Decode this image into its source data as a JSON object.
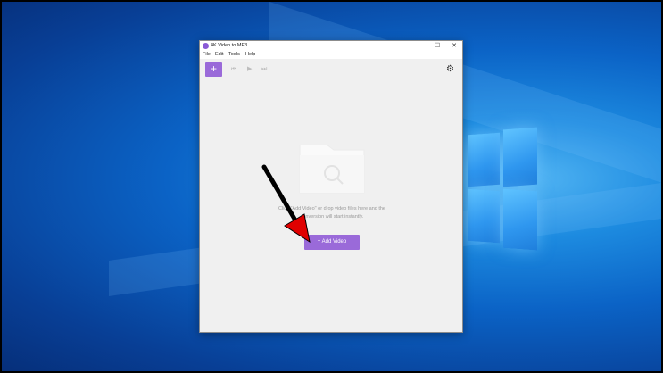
{
  "window": {
    "title": "4K Video to MP3",
    "controls": {
      "minimize": "—",
      "maximize": "☐",
      "close": "✕"
    }
  },
  "menu": {
    "items": [
      "File",
      "Edit",
      "Tools",
      "Help"
    ]
  },
  "toolbar": {
    "add": "+",
    "prev": "⏮",
    "play": "▶",
    "next": "⏭",
    "settings": "⚙"
  },
  "main": {
    "hint_line1": "Click \"Add Video\" or drop video files here and the",
    "hint_line2": "conversion will start instantly.",
    "add_video_label": "+ Add Video"
  },
  "colors": {
    "accent": "#9a6ad9",
    "annotation_arrow": "#e00000"
  }
}
